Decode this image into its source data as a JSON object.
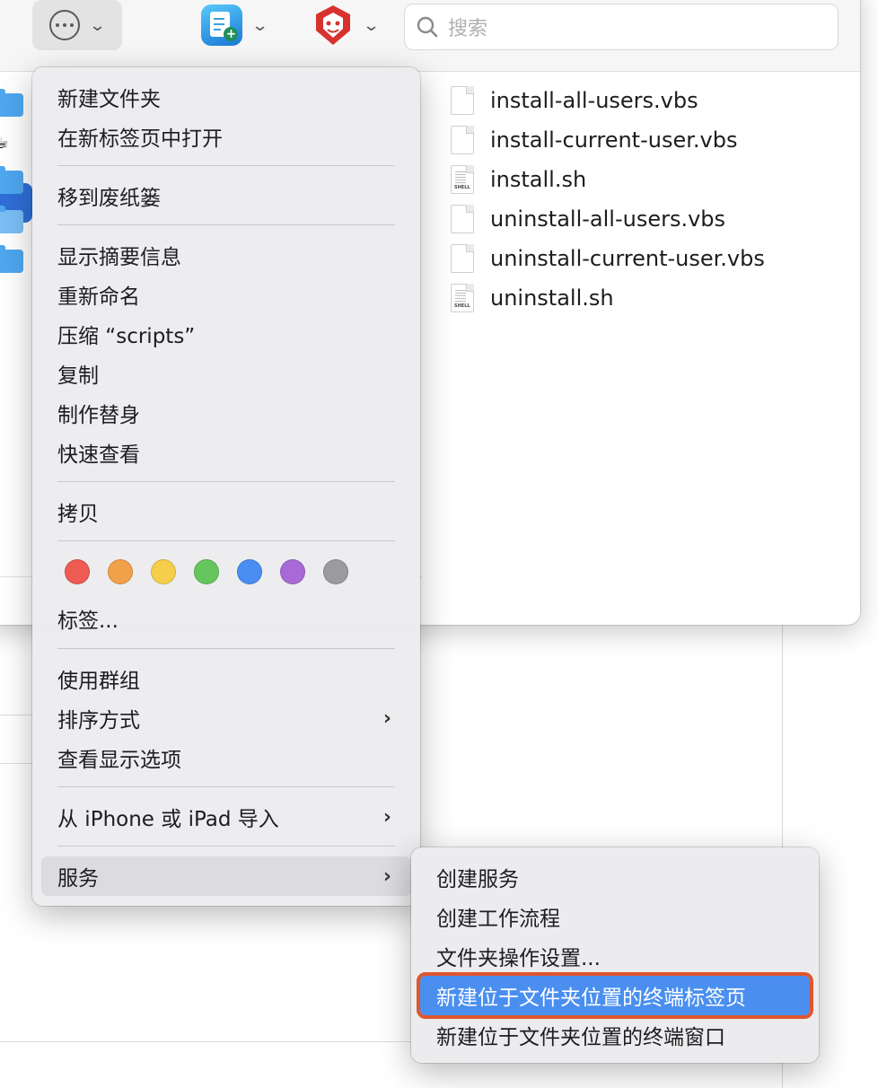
{
  "toolbar": {
    "search_placeholder": "搜索"
  },
  "files": [
    {
      "name": "install-all-users.vbs",
      "kind": "doc"
    },
    {
      "name": "install-current-user.vbs",
      "kind": "doc"
    },
    {
      "name": "install.sh",
      "kind": "shell"
    },
    {
      "name": "uninstall-all-users.vbs",
      "kind": "doc"
    },
    {
      "name": "uninstall-current-user.vbs",
      "kind": "doc"
    },
    {
      "name": "uninstall.sh",
      "kind": "shell"
    }
  ],
  "shell_label": "SHELL",
  "menu": {
    "new_folder": "新建文件夹",
    "open_in_new_tab": "在新标签页中打开",
    "move_to_trash": "移到废纸篓",
    "get_info": "显示摘要信息",
    "rename": "重新命名",
    "compress": "压缩 “scripts”",
    "duplicate": "复制",
    "make_alias": "制作替身",
    "quick_look": "快速查看",
    "copy": "拷贝",
    "tags": "标签...",
    "use_groups": "使用群组",
    "sort_by": "排序方式",
    "show_view_options": "查看显示选项",
    "import_from_iphone": "从 iPhone 或 iPad 导入",
    "services": "服务"
  },
  "tag_colors": [
    "#ee5b52",
    "#f1a14a",
    "#f5cf4b",
    "#64c65c",
    "#4b8ef1",
    "#a86ad6",
    "#9b9b9f"
  ],
  "submenu": {
    "items": [
      "创建服务",
      "创建工作流程",
      "文件夹操作设置...",
      "新建位于文件夹位置的终端标签页",
      "新建位于文件夹位置的终端窗口"
    ]
  }
}
